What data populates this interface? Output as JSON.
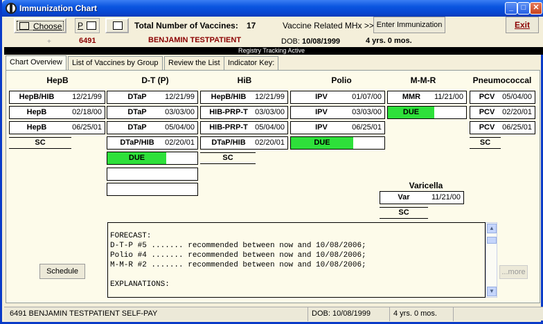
{
  "window": {
    "title": "Immunization Chart",
    "minimize": "_",
    "maximize": "□",
    "close": "✕"
  },
  "toolbar": {
    "choose_label": "Choose",
    "print_label": "P",
    "total_label": "Total Number of Vaccines:",
    "total_value": "17",
    "mhx_label": "Vaccine Related MHx >>",
    "enter_label": "Enter Immunization",
    "exit_label": "Exit"
  },
  "patient": {
    "plus": "+",
    "id": "6491",
    "name": "BENJAMIN TESTPATIENT",
    "dob_label": "DOB:",
    "dob": "10/08/1999",
    "age": "4 yrs. 0 mos."
  },
  "registry": "Registry Tracking Active",
  "tabs": [
    {
      "label": "Chart Overview",
      "active": true
    },
    {
      "label": "List of Vaccines by Group",
      "active": false
    },
    {
      "label": "Review the List",
      "active": false
    },
    {
      "label": "Indicator Key:",
      "active": false
    }
  ],
  "groups": {
    "hepb": {
      "header": "HepB",
      "items": [
        {
          "name": "HepB/HIB",
          "date": "12/21/99"
        },
        {
          "name": "HepB",
          "date": "02/18/00"
        },
        {
          "name": "HepB",
          "date": "06/25/01"
        }
      ],
      "sc": "SC"
    },
    "dtp": {
      "header": "D-T (P)",
      "items": [
        {
          "name": "DTaP",
          "date": "12/21/99"
        },
        {
          "name": "DTaP",
          "date": "03/03/00"
        },
        {
          "name": "DTaP",
          "date": "05/04/00"
        },
        {
          "name": "DTaP/HIB",
          "date": "02/20/01"
        }
      ],
      "due": "DUE"
    },
    "hib": {
      "header": "HiB",
      "items": [
        {
          "name": "HepB/HIB",
          "date": "12/21/99"
        },
        {
          "name": "HIB-PRP-T",
          "date": "03/03/00"
        },
        {
          "name": "HIB-PRP-T",
          "date": "05/04/00"
        },
        {
          "name": "DTaP/HIB",
          "date": "02/20/01"
        }
      ],
      "sc": "SC"
    },
    "polio": {
      "header": "Polio",
      "items": [
        {
          "name": "IPV",
          "date": "01/07/00"
        },
        {
          "name": "IPV",
          "date": "03/03/00"
        },
        {
          "name": "IPV",
          "date": "06/25/01"
        }
      ],
      "due": "DUE"
    },
    "mmr": {
      "header": "M-M-R",
      "items": [
        {
          "name": "MMR",
          "date": "11/21/00"
        }
      ],
      "due": "DUE"
    },
    "pneumo": {
      "header": "Pneumococcal",
      "items": [
        {
          "name": "PCV",
          "date": "05/04/00"
        },
        {
          "name": "PCV",
          "date": "02/20/01"
        },
        {
          "name": "PCV",
          "date": "06/25/01"
        }
      ],
      "sc": "SC"
    },
    "varicella": {
      "header": "Varicella",
      "items": [
        {
          "name": "Var",
          "date": "11/21/00"
        }
      ],
      "sc": "SC"
    }
  },
  "forecast": {
    "text": "FORECAST:\nD-T-P #5 ....... recommended between now and 10/08/2006;\nPolio #4 ....... recommended between now and 10/08/2006;\nM-M-R #2 ....... recommended between now and 10/08/2006;\n\nEXPLANATIONS:"
  },
  "buttons": {
    "schedule": "Schedule",
    "more": "...more"
  },
  "status": {
    "left": "6491 BENJAMIN TESTPATIENT  SELF-PAY",
    "dob": "DOB:  10/08/1999",
    "age": "4 yrs. 0 mos."
  },
  "colors": {
    "due_green": "#2EE03A",
    "patient_red": "#8B0000",
    "title_blue": "#0A55E0"
  }
}
